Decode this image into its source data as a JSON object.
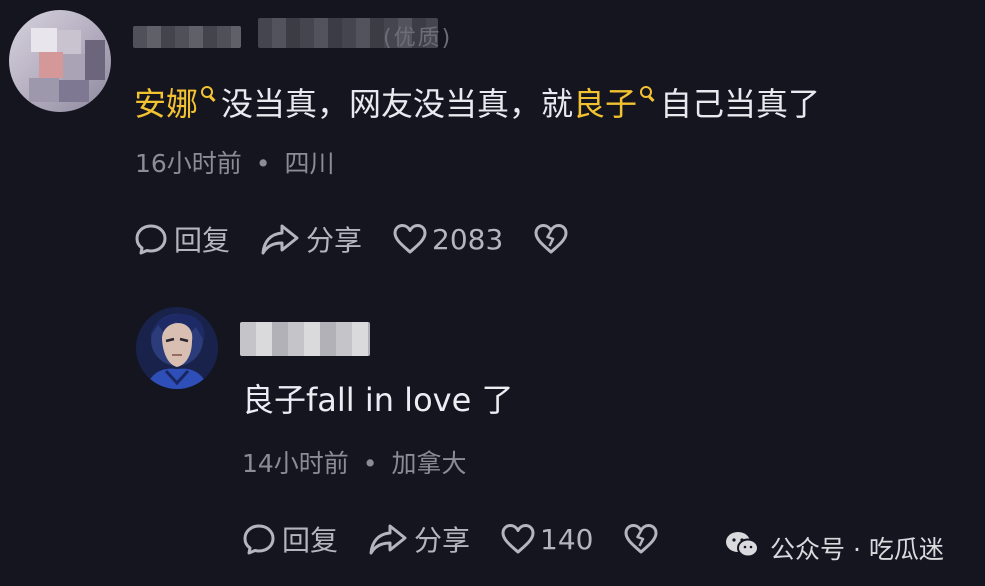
{
  "comments": [
    {
      "username_fragment": "(优质)",
      "text_parts": [
        {
          "text": "安娜",
          "highlight": true
        },
        {
          "text": "没当真，网友没当真，就",
          "highlight": false
        },
        {
          "text": "良子",
          "highlight": true
        },
        {
          "text": "自己当真了",
          "highlight": false
        }
      ],
      "time": "16小时前",
      "location": "四川",
      "reply_label": "回复",
      "share_label": "分享",
      "like_count": "2083"
    },
    {
      "text": "良子fall in love 了",
      "time": "14小时前",
      "location": "加拿大",
      "reply_label": "回复",
      "share_label": "分享",
      "like_count": "140"
    }
  ],
  "watermark": {
    "source": "公众号 · 吃瓜迷"
  },
  "meta_separator": "•",
  "colors": {
    "background": "#15151f",
    "highlight": "#f2c230",
    "meta_text": "#8c8c97",
    "action_text": "#b5b5bf"
  },
  "icons": [
    "search-icon",
    "comment-icon",
    "share-icon",
    "heart-icon",
    "dislike-heart-icon",
    "wechat-icon"
  ]
}
